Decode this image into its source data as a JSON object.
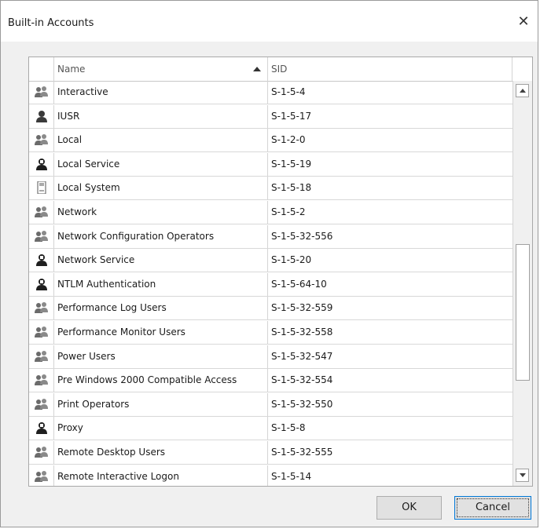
{
  "dialog": {
    "title": "Built-in Accounts",
    "close_icon": "close-icon"
  },
  "columns": {
    "name": "Name",
    "sid": "SID",
    "sort": "ascending"
  },
  "rows": [
    {
      "name": "Interactive",
      "sid": "S-1-5-4",
      "icon": "group-icon"
    },
    {
      "name": "IUSR",
      "sid": "S-1-5-17",
      "icon": "user-icon"
    },
    {
      "name": "Local",
      "sid": "S-1-2-0",
      "icon": "group-icon"
    },
    {
      "name": "Local Service",
      "sid": "S-1-5-19",
      "icon": "service-account-icon"
    },
    {
      "name": "Local System",
      "sid": "S-1-5-18",
      "icon": "computer-icon"
    },
    {
      "name": "Network",
      "sid": "S-1-5-2",
      "icon": "group-icon"
    },
    {
      "name": "Network Configuration Operators",
      "sid": "S-1-5-32-556",
      "icon": "group-icon"
    },
    {
      "name": "Network Service",
      "sid": "S-1-5-20",
      "icon": "service-account-icon"
    },
    {
      "name": "NTLM Authentication",
      "sid": "S-1-5-64-10",
      "icon": "service-account-icon"
    },
    {
      "name": "Performance Log Users",
      "sid": "S-1-5-32-559",
      "icon": "group-icon"
    },
    {
      "name": "Performance Monitor Users",
      "sid": "S-1-5-32-558",
      "icon": "group-icon"
    },
    {
      "name": "Power Users",
      "sid": "S-1-5-32-547",
      "icon": "group-icon"
    },
    {
      "name": "Pre Windows 2000 Compatible Access",
      "sid": "S-1-5-32-554",
      "icon": "group-icon"
    },
    {
      "name": "Print Operators",
      "sid": "S-1-5-32-550",
      "icon": "group-icon"
    },
    {
      "name": "Proxy",
      "sid": "S-1-5-8",
      "icon": "service-account-icon"
    },
    {
      "name": "Remote Desktop Users",
      "sid": "S-1-5-32-555",
      "icon": "group-icon"
    },
    {
      "name": "Remote Interactive Logon",
      "sid": "S-1-5-14",
      "icon": "group-icon"
    }
  ],
  "buttons": {
    "ok": "OK",
    "cancel": "Cancel"
  }
}
